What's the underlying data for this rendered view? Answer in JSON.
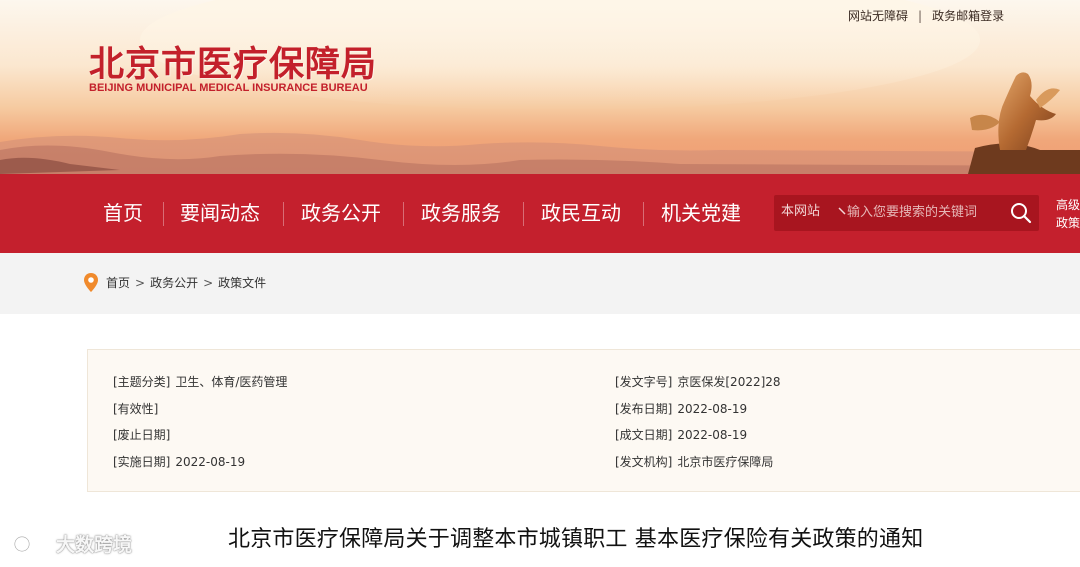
{
  "header": {
    "logo_cn": "北京市医疗保障局",
    "logo_en": "BEIJING MUNICIPAL MEDICAL INSURANCE BUREAU",
    "top_links": [
      "网站无障碍",
      "政务邮箱登录"
    ],
    "top_link_separator": "|"
  },
  "nav": {
    "items": [
      "首页",
      "要闻动态",
      "政务公开",
      "政务服务",
      "政民互动",
      "机关党建"
    ]
  },
  "search": {
    "scope": "本网站",
    "placeholder": "输入您要搜索的关键词",
    "icon": "search-icon"
  },
  "advanced_search": {
    "line1": "高级",
    "line2": "政策"
  },
  "breadcrumb": {
    "icon": "location-pin-icon",
    "items": [
      "首页",
      "政务公开",
      "政策文件"
    ],
    "separator": ">"
  },
  "metadata": {
    "left": [
      {
        "key": "[主题分类]",
        "value": "卫生、体育/医药管理"
      },
      {
        "key": "[有效性]",
        "value": ""
      },
      {
        "key": "[废止日期]",
        "value": ""
      },
      {
        "key": "[实施日期]",
        "value": "2022-08-19"
      }
    ],
    "right": [
      {
        "key": "[发文字号]",
        "value": "京医保发[2022]28"
      },
      {
        "key": "[发布日期]",
        "value": "2022-08-19"
      },
      {
        "key": "[成文日期]",
        "value": "2022-08-19"
      },
      {
        "key": "[发文机构]",
        "value": "北京市医疗保障局"
      }
    ]
  },
  "document": {
    "title": "北京市医疗保障局关于调整本市城镇职工 基本医疗保险有关政策的通知"
  },
  "watermark": {
    "text": "大数跨境",
    "icon": "watermark-logo-icon"
  },
  "colors": {
    "brand_red": "#c4202d",
    "search_bg": "#a8151f",
    "breadcrumb_bg": "#f3f3f3",
    "meta_bg": "#fdf9f3",
    "pin_orange": "#f08a2c"
  }
}
